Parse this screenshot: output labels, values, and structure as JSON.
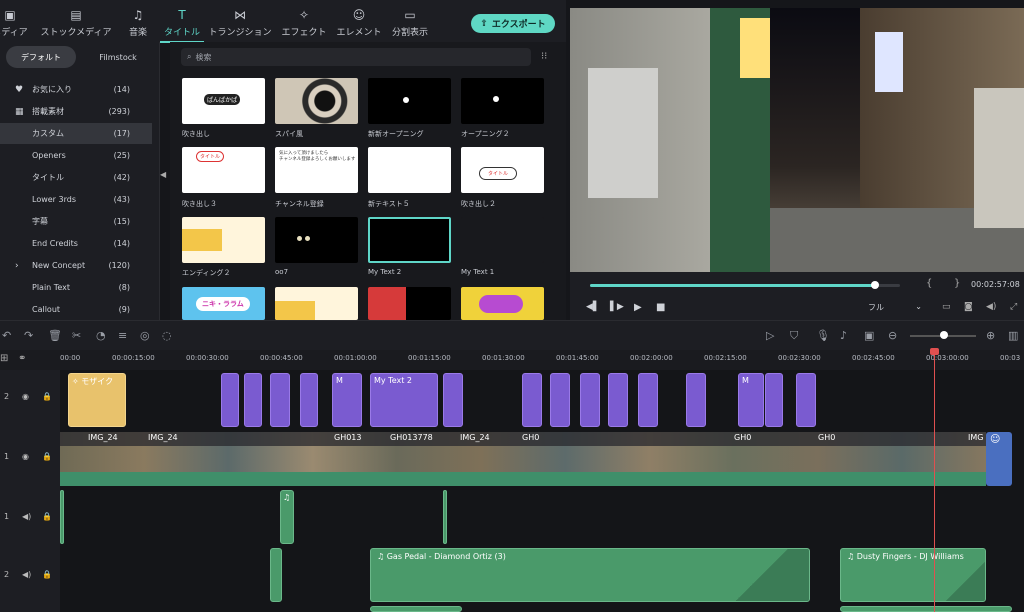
{
  "tabs": [
    {
      "label": "メディア",
      "icon": "image-icon"
    },
    {
      "label": "ストックメディア",
      "icon": "folder-icon"
    },
    {
      "label": "音楽",
      "icon": "music-icon"
    },
    {
      "label": "タイトル",
      "icon": "title-icon"
    },
    {
      "label": "トランジション",
      "icon": "transition-icon"
    },
    {
      "label": "エフェクト",
      "icon": "sparkle-icon"
    },
    {
      "label": "エレメント",
      "icon": "smile-icon"
    },
    {
      "label": "分割表示",
      "icon": "split-icon"
    }
  ],
  "export_label": "エクスポート",
  "segments": {
    "default": "デフォルト",
    "filmstock": "Filmstock"
  },
  "categories": [
    {
      "name": "お気に入り",
      "count": "(14)"
    },
    {
      "name": "搭載素材",
      "count": "(293)"
    },
    {
      "name": "カスタム",
      "count": "(17)"
    },
    {
      "name": "Openers",
      "count": "(25)"
    },
    {
      "name": "タイトル",
      "count": "(42)"
    },
    {
      "name": "Lower 3rds",
      "count": "(43)"
    },
    {
      "name": "字幕",
      "count": "(15)"
    },
    {
      "name": "End Credits",
      "count": "(14)"
    },
    {
      "name": "New Concept",
      "count": "(120)"
    },
    {
      "name": "Plain Text",
      "count": "(8)"
    },
    {
      "name": "Callout",
      "count": "(9)"
    }
  ],
  "search_placeholder": "検索",
  "thumbs": [
    {
      "label": "吹き出し",
      "text": "ぱんぱかぱ"
    },
    {
      "label": "スパイ風",
      "text": ""
    },
    {
      "label": "新新オープニング",
      "text": ""
    },
    {
      "label": "オープニング２",
      "text": ""
    },
    {
      "label": "吹き出し３",
      "text": "タイトル"
    },
    {
      "label": "チャンネル登録",
      "text": "気に入って頂けましたら\nチャンネル登録よろしくお願いします"
    },
    {
      "label": "新テキスト５",
      "text": ""
    },
    {
      "label": "吹き出し２",
      "text": "タイトル"
    },
    {
      "label": "エンディング２",
      "text": ""
    },
    {
      "label": "oo7",
      "text": ""
    },
    {
      "label": "My Text 2",
      "text": ""
    },
    {
      "label": "My Text 1",
      "text": ""
    },
    {
      "label": "",
      "text": "ニキ・ララム"
    },
    {
      "label": "",
      "text": ""
    },
    {
      "label": "",
      "text": ""
    },
    {
      "label": "",
      "text": ""
    }
  ],
  "preview": {
    "time": "00:02:57:08",
    "quality": "フル",
    "progress": 0.92
  },
  "ruler": [
    "00:00",
    "00:00:15:00",
    "00:00:30:00",
    "00:00:45:00",
    "00:01:00:00",
    "00:01:15:00",
    "00:01:30:00",
    "00:01:45:00",
    "00:02:00:00",
    "00:02:15:00",
    "00:02:30:00",
    "00:02:45:00",
    "00:03:00:00",
    "00:03"
  ],
  "track_labels": [
    "2",
    "1",
    "1",
    "2"
  ],
  "title_clips": [
    {
      "label": "モザイク"
    },
    {
      "label": "M"
    },
    {
      "label": "My Text 2"
    },
    {
      "label": "M"
    }
  ],
  "video_labels": [
    "IMG_24",
    "IMG_24",
    "GH013",
    "GH013778",
    "IMG_24",
    "GH0",
    "GH0",
    "GH0",
    "IMG"
  ],
  "audio_clips": [
    {
      "label": "Gas Pedal - Diamond Ortiz (3)"
    },
    {
      "label": "Dusty Fingers - DJ Williams"
    }
  ]
}
